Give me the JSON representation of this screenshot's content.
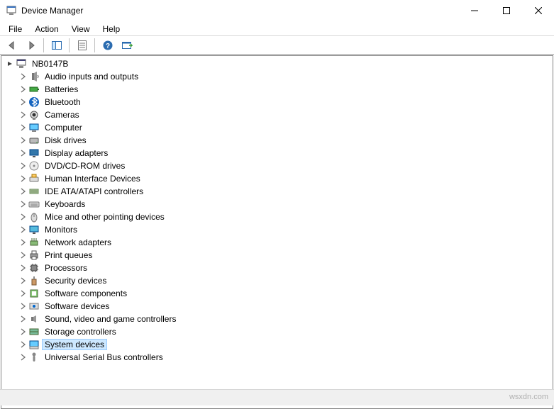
{
  "window": {
    "title": "Device Manager"
  },
  "menu": {
    "file": "File",
    "action": "Action",
    "view": "View",
    "help": "Help"
  },
  "root": {
    "name": "NB0147B"
  },
  "categories": [
    {
      "label": "Audio inputs and outputs",
      "icon": "speaker"
    },
    {
      "label": "Batteries",
      "icon": "battery"
    },
    {
      "label": "Bluetooth",
      "icon": "bluetooth"
    },
    {
      "label": "Cameras",
      "icon": "camera"
    },
    {
      "label": "Computer",
      "icon": "computer"
    },
    {
      "label": "Disk drives",
      "icon": "disk"
    },
    {
      "label": "Display adapters",
      "icon": "display"
    },
    {
      "label": "DVD/CD-ROM drives",
      "icon": "cdrom"
    },
    {
      "label": "Human Interface Devices",
      "icon": "hid"
    },
    {
      "label": "IDE ATA/ATAPI controllers",
      "icon": "ide"
    },
    {
      "label": "Keyboards",
      "icon": "keyboard"
    },
    {
      "label": "Mice and other pointing devices",
      "icon": "mouse"
    },
    {
      "label": "Monitors",
      "icon": "monitor"
    },
    {
      "label": "Network adapters",
      "icon": "network"
    },
    {
      "label": "Print queues",
      "icon": "printer"
    },
    {
      "label": "Processors",
      "icon": "cpu"
    },
    {
      "label": "Security devices",
      "icon": "security"
    },
    {
      "label": "Software components",
      "icon": "swcomp"
    },
    {
      "label": "Software devices",
      "icon": "swdev"
    },
    {
      "label": "Sound, video and game controllers",
      "icon": "sound"
    },
    {
      "label": "Storage controllers",
      "icon": "storage"
    },
    {
      "label": "System devices",
      "icon": "system",
      "selected": true
    },
    {
      "label": "Universal Serial Bus controllers",
      "icon": "usb"
    }
  ],
  "watermark": "wsxdn.com"
}
